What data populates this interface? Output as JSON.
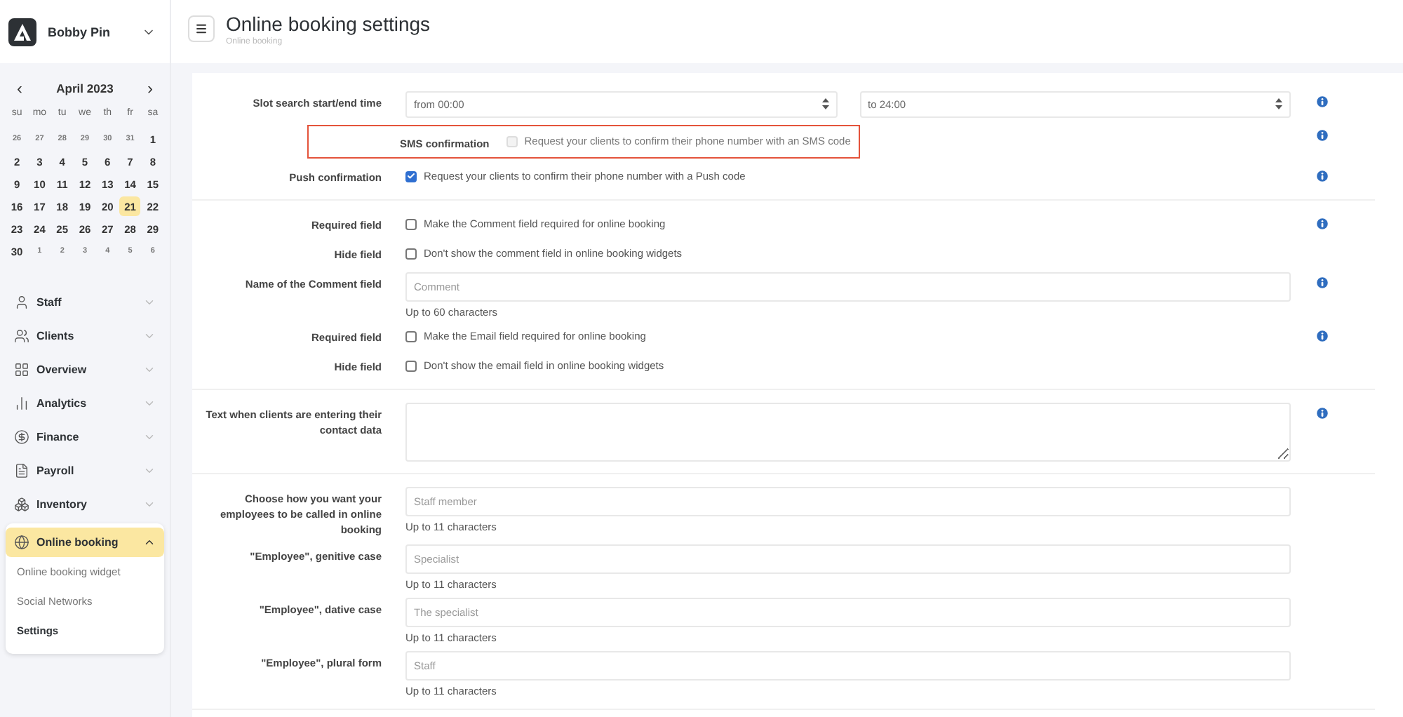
{
  "account": {
    "name": "Bobby Pin"
  },
  "calendar": {
    "month": "April 2023",
    "prev": "‹",
    "next": "›",
    "weekdays": [
      "su",
      "mo",
      "tu",
      "we",
      "th",
      "fr",
      "sa"
    ],
    "days": [
      {
        "label": "26",
        "muted": true,
        "selected": false
      },
      {
        "label": "27",
        "muted": true,
        "selected": false
      },
      {
        "label": "28",
        "muted": true,
        "selected": false
      },
      {
        "label": "29",
        "muted": true,
        "selected": false
      },
      {
        "label": "30",
        "muted": true,
        "selected": false
      },
      {
        "label": "31",
        "muted": true,
        "selected": false
      },
      {
        "label": "1",
        "muted": false,
        "selected": false
      },
      {
        "label": "2",
        "muted": false,
        "selected": false
      },
      {
        "label": "3",
        "muted": false,
        "selected": false
      },
      {
        "label": "4",
        "muted": false,
        "selected": false
      },
      {
        "label": "5",
        "muted": false,
        "selected": false
      },
      {
        "label": "6",
        "muted": false,
        "selected": false
      },
      {
        "label": "7",
        "muted": false,
        "selected": false
      },
      {
        "label": "8",
        "muted": false,
        "selected": false
      },
      {
        "label": "9",
        "muted": false,
        "selected": false
      },
      {
        "label": "10",
        "muted": false,
        "selected": false
      },
      {
        "label": "11",
        "muted": false,
        "selected": false
      },
      {
        "label": "12",
        "muted": false,
        "selected": false
      },
      {
        "label": "13",
        "muted": false,
        "selected": false
      },
      {
        "label": "14",
        "muted": false,
        "selected": false
      },
      {
        "label": "15",
        "muted": false,
        "selected": false
      },
      {
        "label": "16",
        "muted": false,
        "selected": false
      },
      {
        "label": "17",
        "muted": false,
        "selected": false
      },
      {
        "label": "18",
        "muted": false,
        "selected": false
      },
      {
        "label": "19",
        "muted": false,
        "selected": false
      },
      {
        "label": "20",
        "muted": false,
        "selected": false
      },
      {
        "label": "21",
        "muted": false,
        "selected": true
      },
      {
        "label": "22",
        "muted": false,
        "selected": false
      },
      {
        "label": "23",
        "muted": false,
        "selected": false
      },
      {
        "label": "24",
        "muted": false,
        "selected": false
      },
      {
        "label": "25",
        "muted": false,
        "selected": false
      },
      {
        "label": "26",
        "muted": false,
        "selected": false
      },
      {
        "label": "27",
        "muted": false,
        "selected": false
      },
      {
        "label": "28",
        "muted": false,
        "selected": false
      },
      {
        "label": "29",
        "muted": false,
        "selected": false
      },
      {
        "label": "30",
        "muted": false,
        "selected": false
      },
      {
        "label": "1",
        "muted": true,
        "selected": false
      },
      {
        "label": "2",
        "muted": true,
        "selected": false
      },
      {
        "label": "3",
        "muted": true,
        "selected": false
      },
      {
        "label": "4",
        "muted": true,
        "selected": false
      },
      {
        "label": "5",
        "muted": true,
        "selected": false
      },
      {
        "label": "6",
        "muted": true,
        "selected": false
      }
    ]
  },
  "sidebar": {
    "items": [
      {
        "label": "Staff",
        "expanded": false,
        "selected": false
      },
      {
        "label": "Clients",
        "expanded": false,
        "selected": false
      },
      {
        "label": "Overview",
        "expanded": false,
        "selected": false
      },
      {
        "label": "Analytics",
        "expanded": false,
        "selected": false
      },
      {
        "label": "Finance",
        "expanded": false,
        "selected": false
      },
      {
        "label": "Payroll",
        "expanded": false,
        "selected": false
      },
      {
        "label": "Inventory",
        "expanded": false,
        "selected": false
      },
      {
        "label": "Online booking",
        "expanded": true,
        "selected": true,
        "children": [
          {
            "label": "Online booking widget",
            "selected": false
          },
          {
            "label": "Social Networks",
            "selected": false
          },
          {
            "label": "Settings",
            "selected": true
          }
        ]
      }
    ]
  },
  "page": {
    "title": "Online booking settings",
    "breadcrumb": "Online booking"
  },
  "sections": [
    {
      "rows": [
        {
          "kind": "select-pair",
          "label": "Slot search start/end time",
          "from": "from 00:00",
          "to": "to 24:00",
          "info": true
        },
        {
          "kind": "checkbox",
          "label": "SMS confirmation",
          "text": "Request your clients to confirm their phone number with an SMS code",
          "checked": false,
          "disabled": true,
          "highlighted": true,
          "info": true
        },
        {
          "kind": "checkbox",
          "label": "Push confirmation",
          "text": "Request your clients to confirm their phone number with a Push code",
          "checked": true,
          "disabled": false,
          "highlighted": false,
          "info": true
        }
      ]
    },
    {
      "rows": [
        {
          "kind": "checkbox",
          "label": "Required field",
          "text": "Make the Comment field required for online booking",
          "checked": false,
          "disabled": false,
          "highlighted": false,
          "info": true
        },
        {
          "kind": "checkbox",
          "label": "Hide field",
          "text": "Don't show the comment field in online booking widgets",
          "checked": false,
          "disabled": false,
          "highlighted": false,
          "info": false
        },
        {
          "kind": "input",
          "label": "Name of the Comment field",
          "placeholder": "Comment",
          "hint": "Up to 60 characters",
          "info": true
        },
        {
          "kind": "checkbox",
          "label": "Required field",
          "text": "Make the Email field required for online booking",
          "checked": false,
          "disabled": false,
          "highlighted": false,
          "info": true
        },
        {
          "kind": "checkbox",
          "label": "Hide field",
          "text": "Don't show the email field in online booking widgets",
          "checked": false,
          "disabled": false,
          "highlighted": false,
          "info": false
        }
      ]
    },
    {
      "rows": [
        {
          "kind": "textarea",
          "label": "Text when clients are entering their contact data",
          "info": true
        }
      ]
    },
    {
      "rows": [
        {
          "kind": "input",
          "label": "Choose how you want your employees to be called in online booking",
          "placeholder": "Staff member",
          "hint": "Up to 11 characters",
          "info": false
        },
        {
          "kind": "input",
          "label": "\"Employee\", genitive case",
          "placeholder": "Specialist",
          "hint": "Up to 11 characters",
          "info": false
        },
        {
          "kind": "input",
          "label": "\"Employee\", dative case",
          "placeholder": "The specialist",
          "hint": "Up to 11 characters",
          "info": false
        },
        {
          "kind": "input",
          "label": "\"Employee\", plural form",
          "placeholder": "Staff",
          "hint": "Up to 11 characters",
          "info": false
        }
      ]
    }
  ]
}
